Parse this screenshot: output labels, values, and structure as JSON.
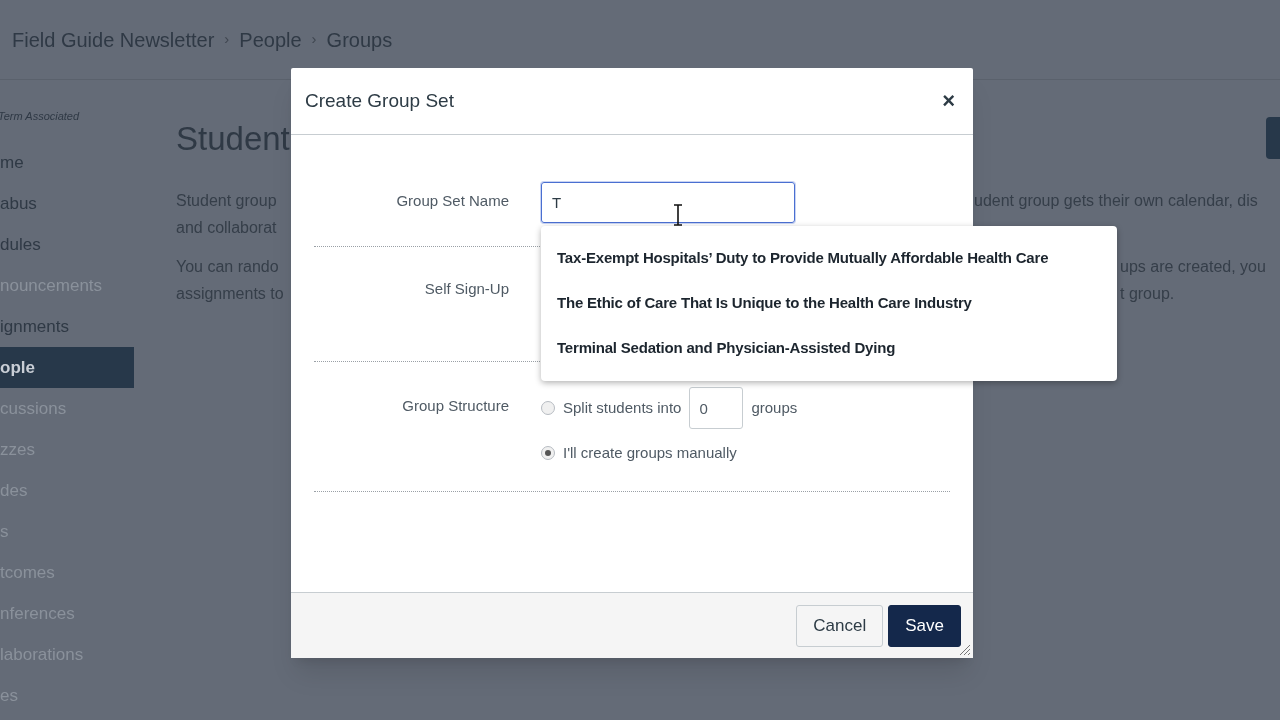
{
  "breadcrumbs": {
    "separator": "›",
    "items": [
      {
        "label": "Field Guide Newsletter"
      },
      {
        "label": "People"
      },
      {
        "label": "Groups"
      }
    ]
  },
  "sidebar": {
    "term": "Term Associated",
    "items": [
      {
        "label": "me",
        "disabled": false,
        "selected": false
      },
      {
        "label": "abus",
        "disabled": false,
        "selected": false
      },
      {
        "label": "dules",
        "disabled": false,
        "selected": false
      },
      {
        "label": "nouncements",
        "disabled": true,
        "selected": false
      },
      {
        "label": "ignments",
        "disabled": false,
        "selected": false
      },
      {
        "label": "ople",
        "disabled": false,
        "selected": true
      },
      {
        "label": "cussions",
        "disabled": true,
        "selected": false
      },
      {
        "label": "zzes",
        "disabled": true,
        "selected": false
      },
      {
        "label": "des",
        "disabled": true,
        "selected": false
      },
      {
        "label": "s",
        "disabled": true,
        "selected": false
      },
      {
        "label": "tcomes",
        "disabled": true,
        "selected": false
      },
      {
        "label": "nferences",
        "disabled": true,
        "selected": false
      },
      {
        "label": "laborations",
        "disabled": true,
        "selected": false
      },
      {
        "label": "es",
        "disabled": true,
        "selected": false
      }
    ]
  },
  "page": {
    "heading": "Student",
    "paragraphs": [
      [
        {
          "left": "Student group",
          "right": "udent group gets their own calendar, dis"
        },
        {
          "left": "and collaborat"
        }
      ],
      [
        {
          "left": "You can rando",
          "right": "ups are created, you"
        },
        {
          "left": "assignments to",
          "right": "t group."
        }
      ]
    ]
  },
  "dialog": {
    "title": "Create Group Set",
    "close": "×",
    "name_field": {
      "label": "Group Set Name",
      "value": "T",
      "focused": true
    },
    "suggestions": [
      {
        "label": "Tax-Exempt Hospitals’ Duty to Provide Mutually Affordable Health Care"
      },
      {
        "label": "The Ethic of Care That Is Unique to the Health Care Industry"
      },
      {
        "label": "Terminal Sedation and Physician-Assisted Dying"
      }
    ],
    "self_sign_up": {
      "label": "Self Sign-Up"
    },
    "group_structure": {
      "label": "Group Structure",
      "options": [
        {
          "kind": "split",
          "before": "Split students into",
          "value": "0",
          "after": "groups",
          "selected": false
        },
        {
          "kind": "manual",
          "label": "I'll create groups manually",
          "selected": true
        }
      ]
    },
    "buttons": [
      {
        "kind": "secondary",
        "label": "Cancel"
      },
      {
        "kind": "primary",
        "label": "Save"
      }
    ]
  }
}
